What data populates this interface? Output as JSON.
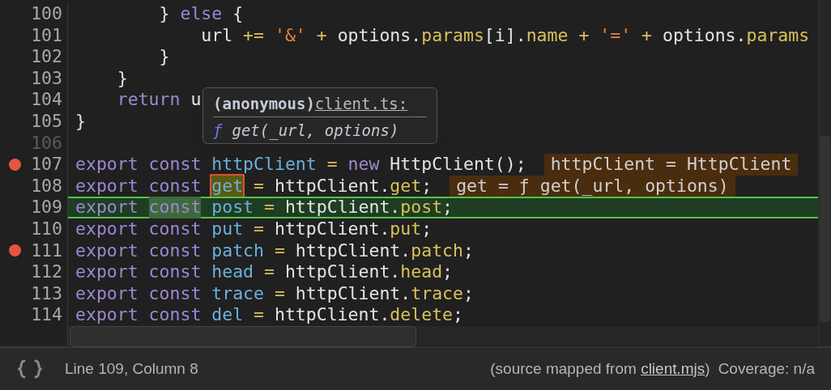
{
  "editor": {
    "lines": [
      {
        "number": "100",
        "breakpoint": false,
        "muted": false,
        "selected": false,
        "tokens": [
          {
            "kind": "plain",
            "text": "        } "
          },
          {
            "kind": "keyword",
            "text": "else"
          },
          {
            "kind": "plain",
            "text": " {"
          }
        ]
      },
      {
        "number": "101",
        "breakpoint": false,
        "muted": false,
        "selected": false,
        "tokens": [
          {
            "kind": "plain",
            "text": "            url "
          },
          {
            "kind": "op",
            "text": "+= "
          },
          {
            "kind": "string",
            "text": "'&' "
          },
          {
            "kind": "op",
            "text": "+"
          },
          {
            "kind": "plain",
            "text": " options."
          },
          {
            "kind": "prop",
            "text": "params"
          },
          {
            "kind": "plain",
            "text": "[i]."
          },
          {
            "kind": "prop",
            "text": "name "
          },
          {
            "kind": "op",
            "text": "+ "
          },
          {
            "kind": "string",
            "text": "'=' "
          },
          {
            "kind": "op",
            "text": "+"
          },
          {
            "kind": "plain",
            "text": " options."
          },
          {
            "kind": "prop",
            "text": "params"
          }
        ]
      },
      {
        "number": "102",
        "breakpoint": false,
        "muted": false,
        "selected": false,
        "tokens": [
          {
            "kind": "plain",
            "text": "        }"
          }
        ]
      },
      {
        "number": "103",
        "breakpoint": false,
        "muted": false,
        "selected": false,
        "tokens": [
          {
            "kind": "plain",
            "text": "    }"
          }
        ]
      },
      {
        "number": "104",
        "breakpoint": false,
        "muted": false,
        "selected": false,
        "tokens": [
          {
            "kind": "keyword",
            "text": "    return"
          },
          {
            "kind": "plain",
            "text": " u"
          }
        ]
      },
      {
        "number": "105",
        "breakpoint": false,
        "muted": false,
        "selected": false,
        "tokens": [
          {
            "kind": "plain",
            "text": "}"
          }
        ]
      },
      {
        "number": "106",
        "breakpoint": false,
        "muted": true,
        "selected": false
      },
      {
        "number": "107",
        "breakpoint": true,
        "muted": false,
        "selected": false,
        "tokens": [
          {
            "kind": "keyword",
            "text": "export const "
          },
          {
            "kind": "ident",
            "text": "httpClient "
          },
          {
            "kind": "op",
            "text": "= "
          },
          {
            "kind": "keyword",
            "text": "new"
          },
          {
            "kind": "plain",
            "text": " HttpClient();"
          }
        ],
        "hint": "httpClient = HttpClient"
      },
      {
        "number": "108",
        "breakpoint": false,
        "muted": false,
        "selected": false,
        "tokens": [
          {
            "kind": "keyword",
            "text": "export const "
          },
          {
            "kind": "ident",
            "text": "get",
            "hovered": true
          },
          {
            "kind": "op",
            "text": " ="
          },
          {
            "kind": "plain",
            "text": " httpClient."
          },
          {
            "kind": "prop",
            "text": "get"
          },
          {
            "kind": "plain",
            "text": ";"
          }
        ],
        "hint": "get = ƒ get(_url, options)"
      },
      {
        "number": "109",
        "breakpoint": false,
        "muted": false,
        "selected": true,
        "tokens": [
          {
            "kind": "keyword",
            "text": "export "
          },
          {
            "kind": "keyword",
            "text": "const",
            "cursor": true,
            "match": true
          },
          {
            "kind": "ident",
            "text": " post "
          },
          {
            "kind": "op",
            "text": "="
          },
          {
            "kind": "plain",
            "text": " httpClient."
          },
          {
            "kind": "prop",
            "text": "post"
          },
          {
            "kind": "plain",
            "text": ";"
          }
        ]
      },
      {
        "number": "110",
        "breakpoint": false,
        "muted": false,
        "selected": false,
        "tokens": [
          {
            "kind": "keyword",
            "text": "export const "
          },
          {
            "kind": "ident",
            "text": "put "
          },
          {
            "kind": "op",
            "text": "="
          },
          {
            "kind": "plain",
            "text": " httpClient."
          },
          {
            "kind": "prop",
            "text": "put"
          },
          {
            "kind": "plain",
            "text": ";"
          }
        ]
      },
      {
        "number": "111",
        "breakpoint": true,
        "muted": false,
        "selected": false,
        "tokens": [
          {
            "kind": "keyword",
            "text": "export const "
          },
          {
            "kind": "ident",
            "text": "patch "
          },
          {
            "kind": "op",
            "text": "="
          },
          {
            "kind": "plain",
            "text": " httpClient."
          },
          {
            "kind": "prop",
            "text": "patch"
          },
          {
            "kind": "plain",
            "text": ";"
          }
        ]
      },
      {
        "number": "112",
        "breakpoint": false,
        "muted": false,
        "selected": false,
        "tokens": [
          {
            "kind": "keyword",
            "text": "export const "
          },
          {
            "kind": "ident",
            "text": "head "
          },
          {
            "kind": "op",
            "text": "="
          },
          {
            "kind": "plain",
            "text": " httpClient."
          },
          {
            "kind": "prop",
            "text": "head"
          },
          {
            "kind": "plain",
            "text": ";"
          }
        ]
      },
      {
        "number": "113",
        "breakpoint": false,
        "muted": false,
        "selected": false,
        "tokens": [
          {
            "kind": "keyword",
            "text": "export const "
          },
          {
            "kind": "ident",
            "text": "trace "
          },
          {
            "kind": "op",
            "text": "="
          },
          {
            "kind": "plain",
            "text": " httpClient."
          },
          {
            "kind": "prop",
            "text": "trace"
          },
          {
            "kind": "plain",
            "text": ";"
          }
        ]
      },
      {
        "number": "114",
        "breakpoint": false,
        "muted": false,
        "selected": false,
        "tokens": [
          {
            "kind": "keyword",
            "text": "export const "
          },
          {
            "kind": "ident",
            "text": "del "
          },
          {
            "kind": "op",
            "text": "="
          },
          {
            "kind": "plain",
            "text": " httpClient."
          },
          {
            "kind": "prop",
            "text": "delete"
          },
          {
            "kind": "plain",
            "text": ";"
          }
        ]
      }
    ]
  },
  "popover": {
    "title": "(anonymous)",
    "link": "client.ts:",
    "function_mark": "ƒ",
    "signature": "get(_url, options)"
  },
  "status_bar": {
    "position": "Line 109, Column 8",
    "source_prefix": "(source mapped from ",
    "source_link": "client.mjs",
    "source_suffix": ")",
    "coverage": "Coverage: n/a"
  }
}
